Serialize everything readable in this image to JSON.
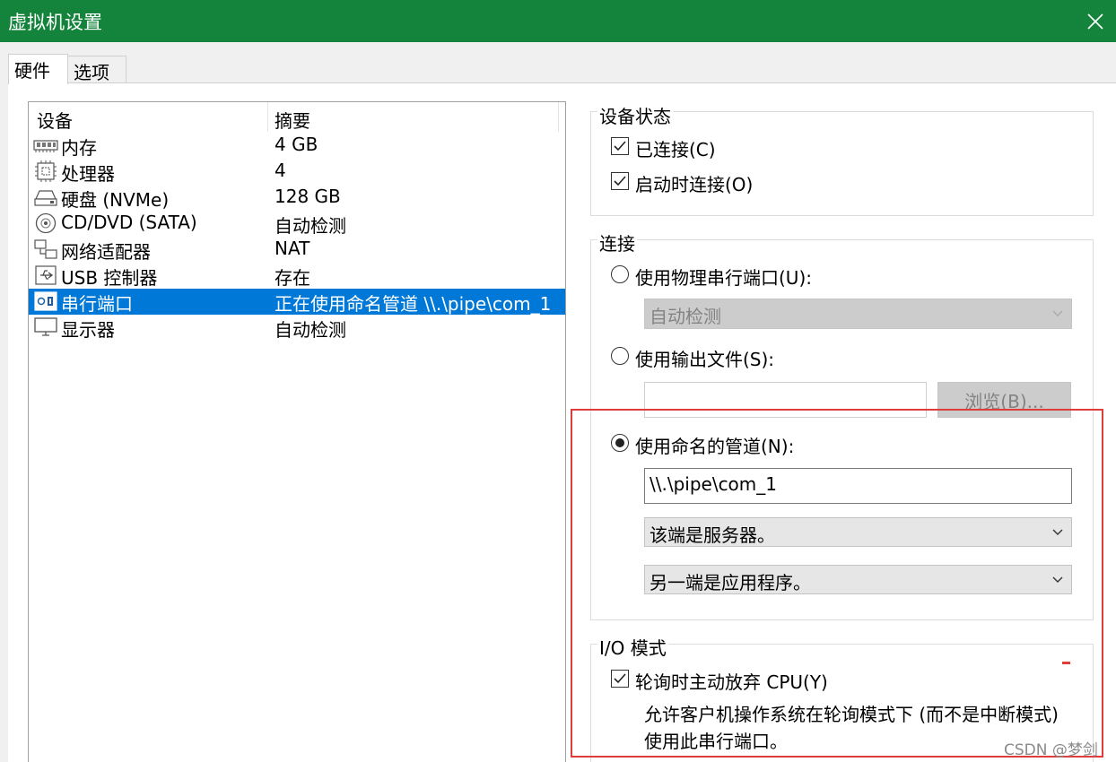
{
  "window": {
    "title": "虚拟机设置"
  },
  "tabs": [
    {
      "label": "硬件",
      "active": true
    },
    {
      "label": "选项",
      "active": false
    }
  ],
  "device_list": {
    "columns": [
      "设备",
      "摘要"
    ],
    "rows": [
      {
        "name": "内存",
        "summary": "4 GB",
        "icon": "memory-icon"
      },
      {
        "name": "处理器",
        "summary": "4",
        "icon": "processor-icon"
      },
      {
        "name": "硬盘 (NVMe)",
        "summary": "128 GB",
        "icon": "hard-disk-icon"
      },
      {
        "name": "CD/DVD (SATA)",
        "summary": "自动检测",
        "icon": "cd-dvd-icon"
      },
      {
        "name": "网络适配器",
        "summary": "NAT",
        "icon": "network-adapter-icon"
      },
      {
        "name": "USB 控制器",
        "summary": "存在",
        "icon": "usb-icon"
      },
      {
        "name": "串行端口",
        "summary": "正在使用命名管道 \\\\.\\pipe\\com_1",
        "icon": "serial-port-icon",
        "selected": true
      },
      {
        "name": "显示器",
        "summary": "自动检测",
        "icon": "display-icon"
      }
    ]
  },
  "device_status": {
    "label": "设备状态",
    "connected": {
      "label": "已连接(C)",
      "checked": true
    },
    "connect_at_power_on": {
      "label": "启动时连接(O)",
      "checked": true
    }
  },
  "connection": {
    "label": "连接",
    "physical_port": {
      "label": "使用物理串行端口(U):",
      "selected": false,
      "dropdown_value": "自动检测"
    },
    "output_file": {
      "label": "使用输出文件(S):",
      "selected": false,
      "value": "",
      "browse_label": "浏览(B)..."
    },
    "named_pipe": {
      "label": "使用命名的管道(N):",
      "selected": true,
      "value": "\\\\.\\pipe\\com_1",
      "this_end": "该端是服务器。",
      "other_end": "另一端是应用程序。"
    }
  },
  "io_mode": {
    "label": "I/O 模式",
    "yield_cpu": {
      "label": "轮询时主动放弃 CPU(Y)",
      "checked": true
    },
    "description": "允许客户机操作系统在轮询模式下 (而不是中断模式)使用此串行端口。"
  },
  "watermark": "CSDN @梦剑",
  "colors": {
    "titlebar": "#14843c",
    "selection": "#0078d7",
    "highlight_box": "#e03c3c"
  }
}
